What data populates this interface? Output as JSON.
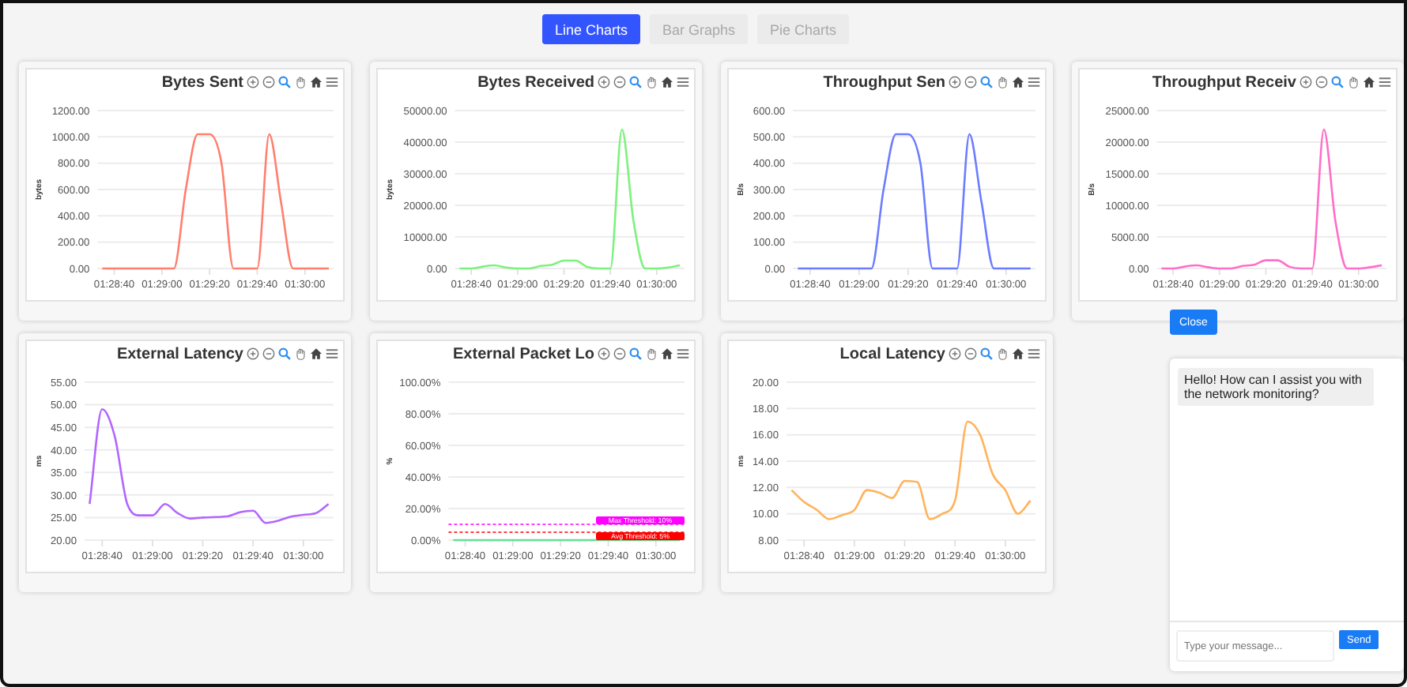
{
  "tabs": [
    {
      "label": "Line Charts",
      "selected": true
    },
    {
      "label": "Bar Graphs",
      "selected": false
    },
    {
      "label": "Pie Charts",
      "selected": false
    }
  ],
  "charts": [
    {
      "chart_data": {
        "type": "line",
        "title": "Bytes Sent",
        "ylabel": "bytes",
        "categories": [
          null,
          "01:28:40",
          null,
          null,
          null,
          "01:29:00",
          null,
          null,
          null,
          "01:29:20",
          null,
          null,
          null,
          "01:29:40",
          null,
          null,
          null,
          "01:30:00",
          null,
          null
        ],
        "series": [
          {
            "color": "#ff7f6e",
            "values": [
              0,
              0,
              0,
              0,
              0,
              0,
              0,
              600,
              1020,
              1020,
              800,
              0,
              0,
              0,
              1020,
              500,
              0,
              0,
              0,
              0
            ]
          }
        ],
        "grid": true,
        "ylim": [
          0,
          1200
        ],
        "yticks": [
          {
            "value": 0,
            "label": "0.00"
          },
          {
            "value": 200,
            "label": "200.00"
          },
          {
            "value": 400,
            "label": "400.00"
          },
          {
            "value": 600,
            "label": "600.00"
          },
          {
            "value": 800,
            "label": "800.00"
          },
          {
            "value": 1000,
            "label": "1000.00"
          },
          {
            "value": 1200,
            "label": "1200.00"
          }
        ]
      }
    },
    {
      "chart_data": {
        "type": "line",
        "title": "Bytes Received",
        "ylabel": "bytes",
        "categories": [
          null,
          "01:28:40",
          null,
          null,
          null,
          "01:29:00",
          null,
          null,
          null,
          "01:29:20",
          null,
          null,
          null,
          "01:29:40",
          null,
          null,
          null,
          "01:30:00",
          null,
          null
        ],
        "series": [
          {
            "color": "#7cf27c",
            "values": [
              0,
              0,
              600,
              1000,
              300,
              0,
              0,
              800,
              1200,
              2500,
              2500,
              500,
              0,
              0,
              44000,
              15000,
              0,
              0,
              300,
              1000
            ]
          }
        ],
        "grid": true,
        "ylim": [
          0,
          50000
        ],
        "yticks": [
          {
            "value": 0,
            "label": "0.00"
          },
          {
            "value": 10000,
            "label": "10000.00"
          },
          {
            "value": 20000,
            "label": "20000.00"
          },
          {
            "value": 30000,
            "label": "30000.00"
          },
          {
            "value": 40000,
            "label": "40000.00"
          },
          {
            "value": 50000,
            "label": "50000.00"
          }
        ]
      }
    },
    {
      "chart_data": {
        "type": "line",
        "title": "Throughput Sen",
        "ylabel": "B/s",
        "categories": [
          null,
          "01:28:40",
          null,
          null,
          null,
          "01:29:00",
          null,
          null,
          null,
          "01:29:20",
          null,
          null,
          null,
          "01:29:40",
          null,
          null,
          null,
          "01:30:00",
          null,
          null
        ],
        "series": [
          {
            "color": "#6b7cff",
            "values": [
              0,
              0,
              0,
              0,
              0,
              0,
              0,
              300,
              510,
              510,
              400,
              0,
              0,
              0,
              510,
              250,
              0,
              0,
              0,
              0
            ]
          }
        ],
        "grid": true,
        "ylim": [
          0,
          600
        ],
        "yticks": [
          {
            "value": 0,
            "label": "0.00"
          },
          {
            "value": 100,
            "label": "100.00"
          },
          {
            "value": 200,
            "label": "200.00"
          },
          {
            "value": 300,
            "label": "300.00"
          },
          {
            "value": 400,
            "label": "400.00"
          },
          {
            "value": 500,
            "label": "500.00"
          },
          {
            "value": 600,
            "label": "600.00"
          }
        ]
      }
    },
    {
      "chart_data": {
        "type": "line",
        "title": "Throughput Receiv",
        "ylabel": "B/s",
        "categories": [
          null,
          "01:28:40",
          null,
          null,
          null,
          "01:29:00",
          null,
          null,
          null,
          "01:29:20",
          null,
          null,
          null,
          "01:29:40",
          null,
          null,
          null,
          "01:30:00",
          null,
          null
        ],
        "series": [
          {
            "color": "#ff6ec7",
            "values": [
              0,
              0,
              300,
              500,
              200,
              0,
              0,
              400,
              600,
              1300,
              1300,
              300,
              0,
              0,
              22000,
              7500,
              0,
              0,
              200,
              500
            ]
          }
        ],
        "grid": true,
        "ylim": [
          0,
          25000
        ],
        "yticks": [
          {
            "value": 0,
            "label": "0.00"
          },
          {
            "value": 5000,
            "label": "5000.00"
          },
          {
            "value": 10000,
            "label": "10000.00"
          },
          {
            "value": 15000,
            "label": "15000.00"
          },
          {
            "value": 20000,
            "label": "20000.00"
          },
          {
            "value": 25000,
            "label": "25000.00"
          }
        ]
      }
    },
    {
      "chart_data": {
        "type": "line",
        "title": "External Latency",
        "ylabel": "ms",
        "categories": [
          null,
          "01:28:40",
          null,
          null,
          null,
          "01:29:00",
          null,
          null,
          null,
          "01:29:20",
          null,
          null,
          null,
          "01:29:40",
          null,
          null,
          null,
          "01:30:00",
          null,
          null
        ],
        "series": [
          {
            "color": "#b266ff",
            "values": [
              28,
              49,
              43,
              28,
              25.5,
              25.5,
              28,
              26,
              24.8,
              25,
              25.1,
              25.3,
              26.2,
              26.5,
              23.8,
              24.3,
              25.2,
              25.6,
              26,
              28
            ]
          }
        ],
        "grid": true,
        "ylim": [
          20,
          55
        ],
        "yticks": [
          {
            "value": 20,
            "label": "20.00"
          },
          {
            "value": 25,
            "label": "25.00"
          },
          {
            "value": 30,
            "label": "30.00"
          },
          {
            "value": 35,
            "label": "35.00"
          },
          {
            "value": 40,
            "label": "40.00"
          },
          {
            "value": 45,
            "label": "45.00"
          },
          {
            "value": 50,
            "label": "50.00"
          },
          {
            "value": 55,
            "label": "55.00"
          }
        ]
      }
    },
    {
      "chart_data": {
        "type": "line",
        "title": "External Packet Lo",
        "ylabel": "%",
        "categories": [
          null,
          "01:28:40",
          null,
          null,
          null,
          "01:29:00",
          null,
          null,
          null,
          "01:29:20",
          null,
          null,
          null,
          "01:29:40",
          null,
          null,
          null,
          "01:30:00",
          null,
          null
        ],
        "series": [
          {
            "color": "#66dd99",
            "values": [
              0,
              0,
              0,
              0,
              0,
              0,
              0,
              0,
              0,
              0,
              0,
              0,
              0,
              0,
              0,
              0,
              0,
              0,
              0,
              0
            ]
          }
        ],
        "grid": true,
        "ylim": [
          0,
          100
        ],
        "yticks": [
          {
            "value": 0,
            "label": "0.00%"
          },
          {
            "value": 20,
            "label": "20.00%"
          },
          {
            "value": 40,
            "label": "40.00%"
          },
          {
            "value": 60,
            "label": "60.00%"
          },
          {
            "value": 80,
            "label": "80.00%"
          },
          {
            "value": 100,
            "label": "100.00%"
          }
        ],
        "ref_lines": [
          {
            "axis": "y",
            "value": 10,
            "label": "Max Threshold: 10%",
            "color": "#ff00ff"
          },
          {
            "axis": "y",
            "value": 5,
            "label": "Avg Threshold: 5%",
            "color": "#ff0000"
          }
        ]
      }
    },
    {
      "chart_data": {
        "type": "line",
        "title": "Local Latency",
        "ylabel": "ms",
        "categories": [
          null,
          "01:28:40",
          null,
          null,
          null,
          "01:29:00",
          null,
          null,
          null,
          "01:29:20",
          null,
          null,
          null,
          "01:29:40",
          null,
          null,
          null,
          "01:30:00",
          null,
          null
        ],
        "series": [
          {
            "color": "#ffb35c",
            "values": [
              11.8,
              10.9,
              10.3,
              9.6,
              9.9,
              10.3,
              11.8,
              11.6,
              11.2,
              12.5,
              12.4,
              9.6,
              10,
              11,
              17,
              16,
              13,
              11.8,
              10,
              11
            ]
          }
        ],
        "grid": true,
        "ylim": [
          8,
          20
        ],
        "yticks": [
          {
            "value": 8,
            "label": "8.00"
          },
          {
            "value": 10,
            "label": "10.00"
          },
          {
            "value": 12,
            "label": "12.00"
          },
          {
            "value": 14,
            "label": "14.00"
          },
          {
            "value": 16,
            "label": "16.00"
          },
          {
            "value": 18,
            "label": "18.00"
          },
          {
            "value": 20,
            "label": "20.00"
          }
        ]
      }
    }
  ],
  "close_button": "Close",
  "chat": {
    "messages": [
      {
        "text": "Hello! How can I assist you with the network monitoring?"
      }
    ],
    "input": {
      "placeholder": "Type your message..."
    },
    "send_button": "Send"
  }
}
